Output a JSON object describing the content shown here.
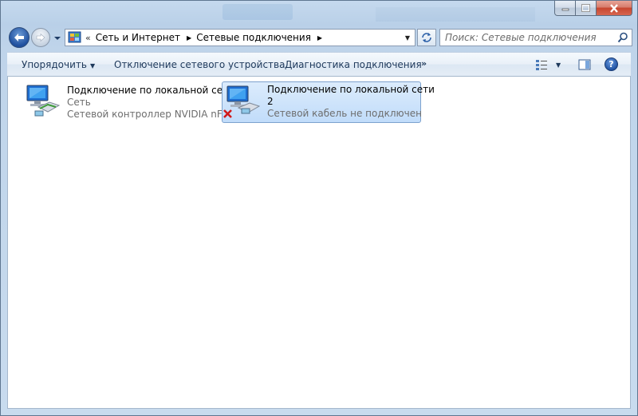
{
  "window": {
    "caption_buttons": [
      "minimize-icon",
      "maximize-icon",
      "close-icon"
    ]
  },
  "navigation": {
    "back_icon": "back-arrow-icon",
    "forward_icon": "forward-arrow-icon",
    "address": {
      "overflow": "«",
      "crumbs": [
        "Сеть и Интернет",
        "Сетевые подключения"
      ]
    },
    "search": {
      "placeholder": "Поиск: Сетевые подключения"
    }
  },
  "command_bar": {
    "organize": "Упорядочить",
    "disable_device": "Отключение сетевого устройства",
    "diagnose": "Диагностика подключения",
    "more": "»"
  },
  "connections": [
    {
      "name": "Подключение по локальной сети",
      "name_line2": "",
      "network": "Сеть",
      "status": "Сетевой контроллер NVIDIA nFo...",
      "selected": false,
      "disconnected": false
    },
    {
      "name": "Подключение по локальной сети",
      "name_line2": "2",
      "network": "",
      "status": "Сетевой кабель не подключен",
      "selected": true,
      "disconnected": true
    }
  ],
  "colors": {
    "accent": "#1e395b",
    "selection": "#c1dcfa",
    "error": "#d11a1a"
  }
}
